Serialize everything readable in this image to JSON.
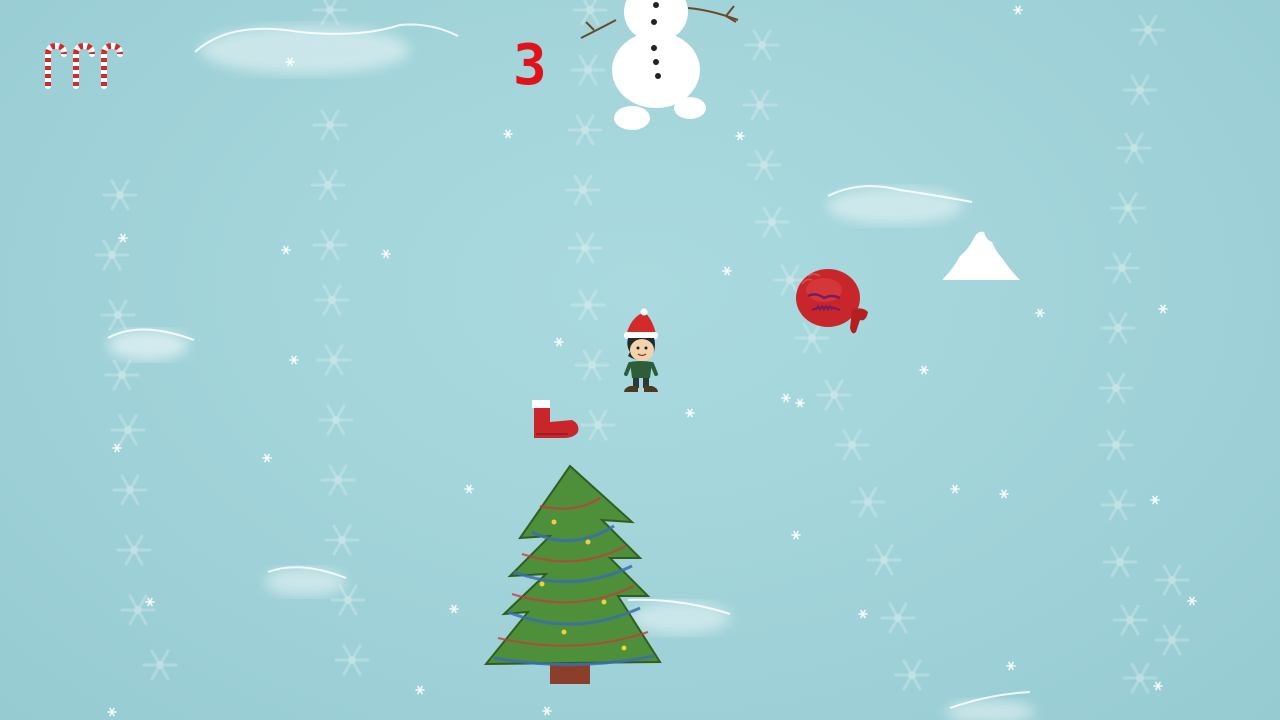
{
  "game": {
    "score": "3",
    "lives_icon": "candy-cane-icon",
    "lives_count": 3
  },
  "colors": {
    "background": "#a6d6dc",
    "score": "#e0121b",
    "tree": "#4e8f3a",
    "sack": "#c8262a"
  },
  "sprites": [
    "snowman",
    "elf-player",
    "santa-boot",
    "santa-sack-enemy",
    "christmas-tree",
    "snow-pile"
  ]
}
